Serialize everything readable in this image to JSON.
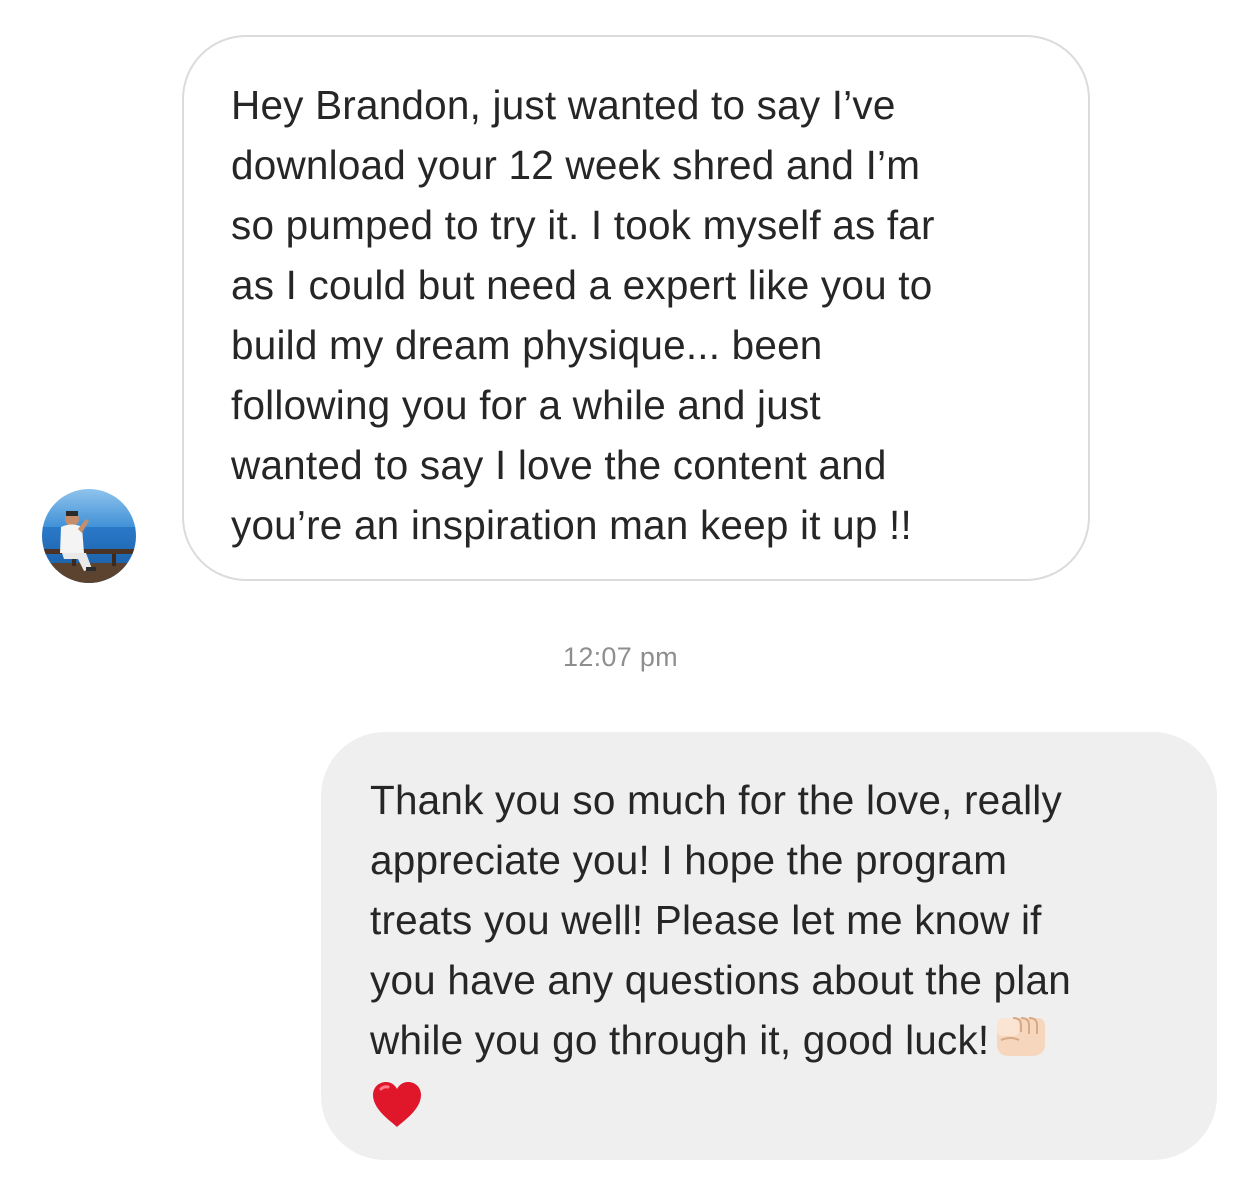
{
  "conversation": {
    "incoming": {
      "avatar_icon": "profile-photo-man-by-sea",
      "text": "Hey Brandon, just wanted to say I’ve\ndownload your 12 week shred and I’m\nso pumped to try it. I took myself as far\nas I could but need a expert like you to\nbuild my dream physique... been\nfollowing you for a while and just\nwanted to say I love the content and\nyou’re an inspiration man keep it up !!"
    },
    "timestamp": "12:07 pm",
    "outgoing": {
      "text": "Thank you so much for the love, really\nappreciate you! I hope the program\ntreats you well! Please let me know if\nyou have any questions about the plan\nwhile you go through it, good luck!",
      "emojis": [
        "fist-emoji",
        "red-heart-emoji"
      ]
    }
  },
  "colors": {
    "incoming_border": "#dbdbdb",
    "outgoing_bg": "#efefef",
    "text": "#262626",
    "timestamp": "#8e8e8e",
    "heart": "#e0162b"
  }
}
